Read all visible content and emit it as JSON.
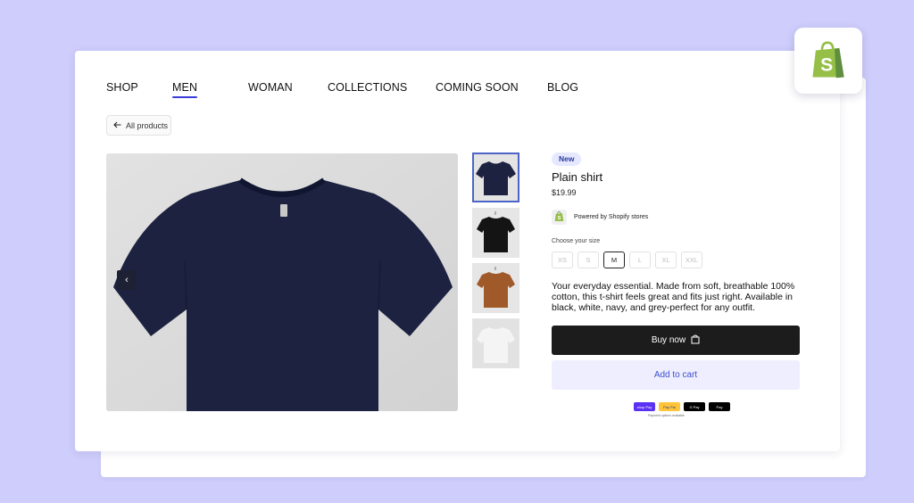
{
  "nav": {
    "items": [
      {
        "label": "SHOP"
      },
      {
        "label": "MEN",
        "active": true
      },
      {
        "label": "WOMAN"
      },
      {
        "label": "COLLECTIONS"
      },
      {
        "label": "COMING SOON"
      },
      {
        "label": "BLOG"
      }
    ]
  },
  "back_button": {
    "label": "All products",
    "icon": "arrow-left-icon"
  },
  "gallery": {
    "main_color": "#1c2240",
    "prev_icon": "chevron-left-icon",
    "prev_glyph": "‹",
    "thumbnails": [
      {
        "color": "#1c2240",
        "selected": true
      },
      {
        "color": "#141414",
        "selected": false
      },
      {
        "color": "#a05a2a",
        "selected": false
      },
      {
        "color": "#f2f2f2",
        "selected": false
      }
    ]
  },
  "product": {
    "badge": "New",
    "title": "Plain shirt",
    "price": "$19.99",
    "powered_by": "Powered by Shopify stores",
    "size_label": "Choose your size",
    "sizes": [
      "XS",
      "S",
      "M",
      "L",
      "XL",
      "XXL"
    ],
    "selected_size": "M",
    "description": "Your everyday essential. Made from soft, breathable 100% cotton, this t-shirt feels great and fits just right. Available in black, white, navy, and grey-perfect for any outfit.",
    "buy_now": "Buy now",
    "add_to_cart": "Add to cart",
    "payment_methods": [
      {
        "label": "shop Pay",
        "color": "#5a31f4",
        "text_color": "#ffffff"
      },
      {
        "label": "Pay Pal",
        "color": "#ffc439",
        "text_color": "#253b80"
      },
      {
        "label": "G Pay",
        "color": "#000000",
        "text_color": "#ffffff"
      },
      {
        "label": " Pay",
        "color": "#000000",
        "text_color": "#ffffff"
      }
    ],
    "payment_note": "Payment options available"
  },
  "colors": {
    "accent": "#3b3bdb",
    "shopify_green": "#95bf47",
    "background": "#cfcdfb"
  }
}
